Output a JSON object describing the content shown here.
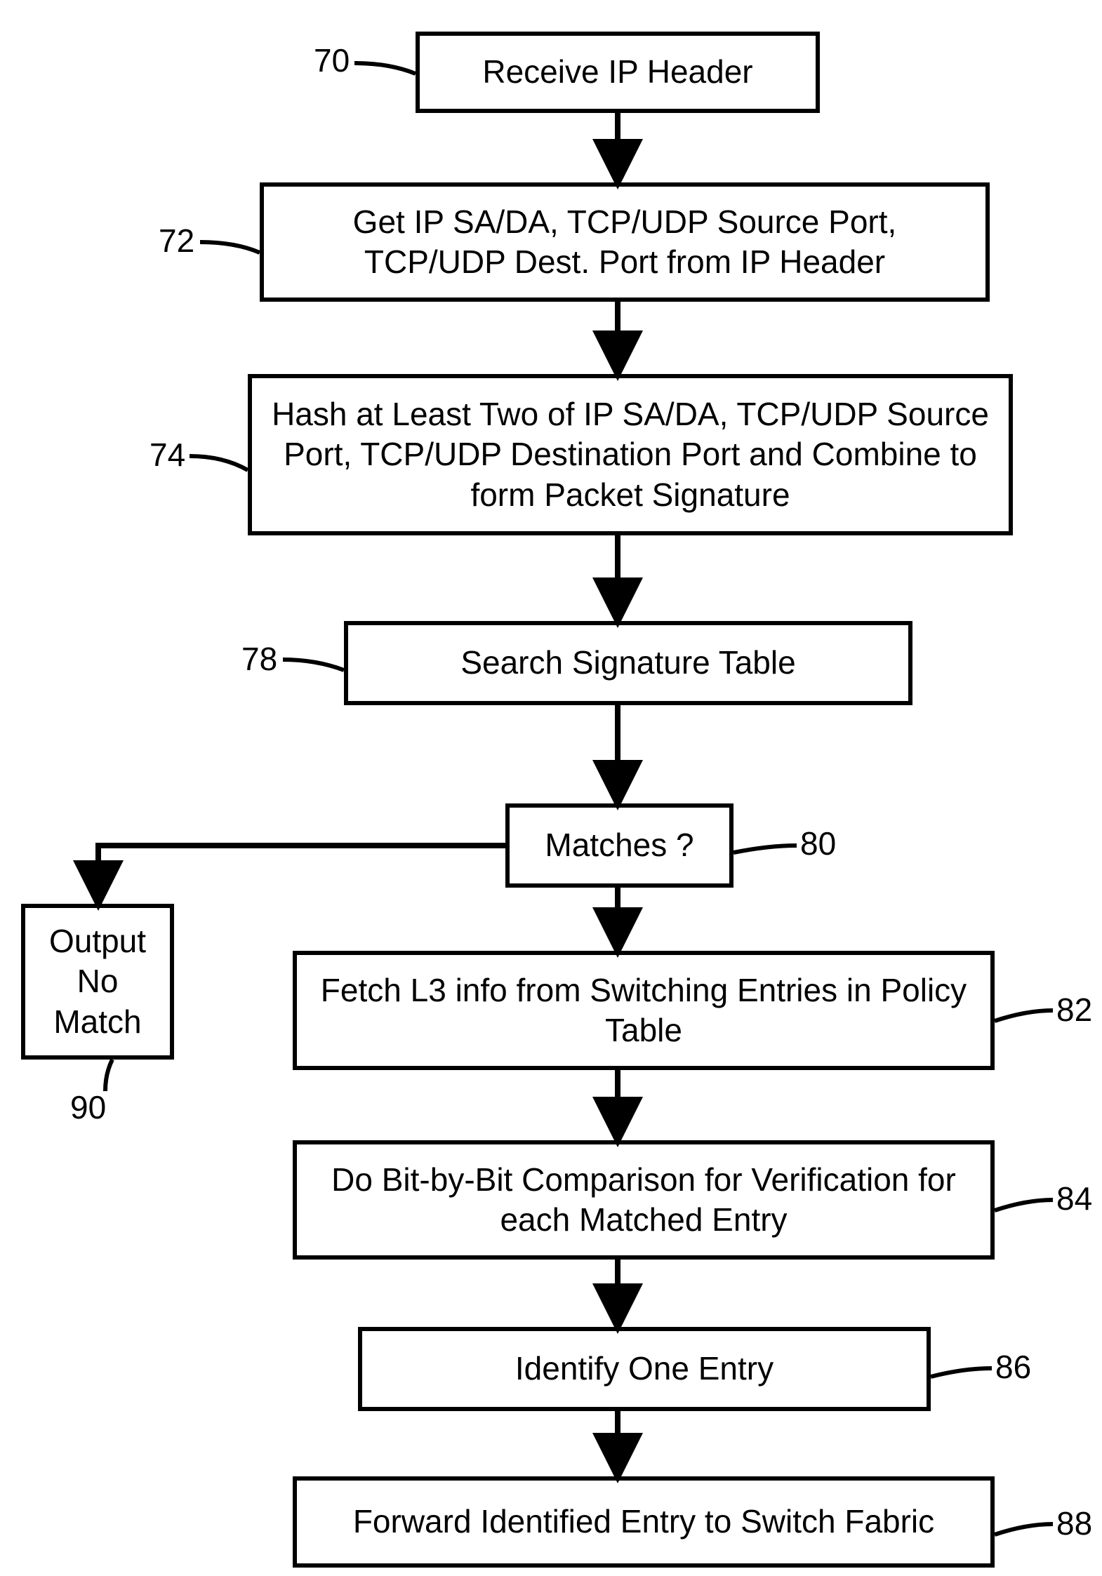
{
  "labels": {
    "n70": "70",
    "n72": "72",
    "n74": "74",
    "n78": "78",
    "n80": "80",
    "n82": "82",
    "n84": "84",
    "n86": "86",
    "n88": "88",
    "n90": "90"
  },
  "nodes": {
    "b70": "Receive IP Header",
    "b72": "Get IP SA/DA, TCP/UDP Source Port, TCP/UDP Dest. Port from IP Header",
    "b74": "Hash at Least Two of IP SA/DA, TCP/UDP Source Port, TCP/UDP Destination Port and Combine to form Packet Signature",
    "b78": "Search Signature Table",
    "b80": "Matches ?",
    "b82": "Fetch L3 info from Switching Entries in Policy Table",
    "b84": "Do Bit-by-Bit Comparison for Verification for each Matched Entry",
    "b86": "Identify One Entry",
    "b88": "Forward Identified Entry to Switch Fabric",
    "b90": "Output No Match"
  }
}
